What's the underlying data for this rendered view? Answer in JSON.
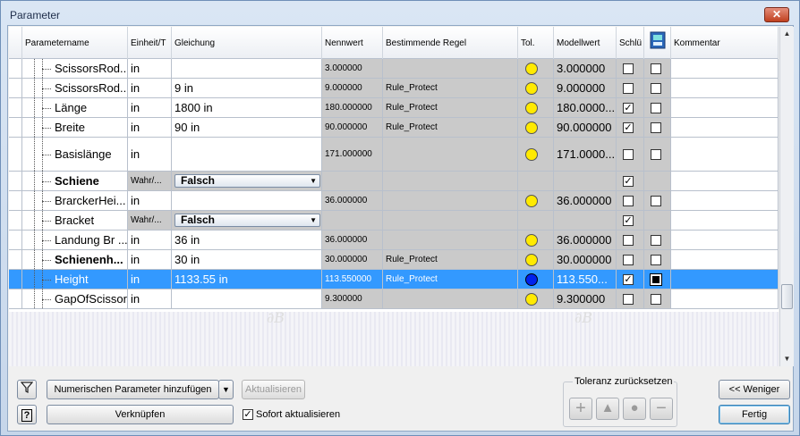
{
  "window": {
    "title": "Parameter",
    "close": "✕"
  },
  "columns": [
    "Parametername",
    "Einheit/T",
    "Gleichung",
    "Nennwert",
    "Bestimmende Regel",
    "Tol.",
    "Modellwert",
    "Schlü",
    "",
    "Kommentar"
  ],
  "rows": [
    {
      "name": "ScissorsRod...",
      "unit": "in",
      "equation": "",
      "nominal": "3.000000",
      "rule": "",
      "tol": "yellow",
      "model": "3.000000",
      "key": false,
      "export": false
    },
    {
      "name": "ScissorsRod...",
      "unit": "in",
      "equation": "9 in",
      "nominal": "9.000000",
      "rule": "Rule_Protect",
      "tol": "yellow",
      "model": "9.000000",
      "key": false,
      "export": false
    },
    {
      "name": "Länge",
      "unit": "in",
      "equation": "1800 in",
      "nominal": "180.000000",
      "rule": "Rule_Protect",
      "tol": "yellow",
      "model": "180.0000...",
      "key": true,
      "export": false
    },
    {
      "name": "Breite",
      "unit": "in",
      "equation": "90 in",
      "nominal": "90.000000",
      "rule": "Rule_Protect",
      "tol": "yellow",
      "model": "90.000000",
      "key": true,
      "export": false
    },
    {
      "name": "Basislänge",
      "unit": "in",
      "equation": "",
      "nominal": "171.000000",
      "rule": "",
      "tol": "yellow",
      "model": "171.0000...",
      "key": false,
      "export": false
    },
    {
      "name": "Schiene",
      "unit": "Wahr/...",
      "equation": "Falsch",
      "nominal": "",
      "rule": "",
      "tol": "",
      "model": "",
      "key": true,
      "export": null
    },
    {
      "name": "BrarckerHei...",
      "unit": "in",
      "equation": "",
      "nominal": "36.000000",
      "rule": "",
      "tol": "yellow",
      "model": "36.000000",
      "key": false,
      "export": false
    },
    {
      "name": "Bracket",
      "unit": "Wahr/...",
      "equation": "Falsch",
      "nominal": "",
      "rule": "",
      "tol": "",
      "model": "",
      "key": true,
      "export": null
    },
    {
      "name": "Landung Br ...",
      "unit": "in",
      "equation": "36 in",
      "nominal": "36.000000",
      "rule": "",
      "tol": "yellow",
      "model": "36.000000",
      "key": false,
      "export": false
    },
    {
      "name": "Schienenh...",
      "unit": "in",
      "equation": "30 in",
      "nominal": "30.000000",
      "rule": "Rule_Protect",
      "tol": "yellow",
      "model": "30.000000",
      "key": false,
      "export": false
    },
    {
      "name": "Height",
      "unit": "in",
      "equation": "1133.55 in",
      "nominal": "113.550000",
      "rule": "Rule_Protect",
      "tol": "blue",
      "model": "113.550...",
      "key": true,
      "export": true
    },
    {
      "name": "GapOfScissors",
      "unit": "in",
      "equation": "",
      "nominal": "9.300000",
      "rule": "",
      "tol": "yellow",
      "model": "9.300000",
      "key": false,
      "export": false
    }
  ],
  "buttons": {
    "add_numeric": "Numerischen Parameter hinzufügen",
    "update": "Aktualisieren",
    "link": "Verknüpfen",
    "less": "<< Weniger",
    "done": "Fertig"
  },
  "auto_update_label": "Sofort aktualisieren",
  "tolerance": {
    "label": "Toleranz zurücksetzen",
    "buttons": [
      "+",
      "▲",
      "●",
      "−"
    ]
  },
  "colors": {
    "selection": "#3399ff",
    "led_yellow": "#ffea00",
    "led_blue": "#0022ee"
  }
}
